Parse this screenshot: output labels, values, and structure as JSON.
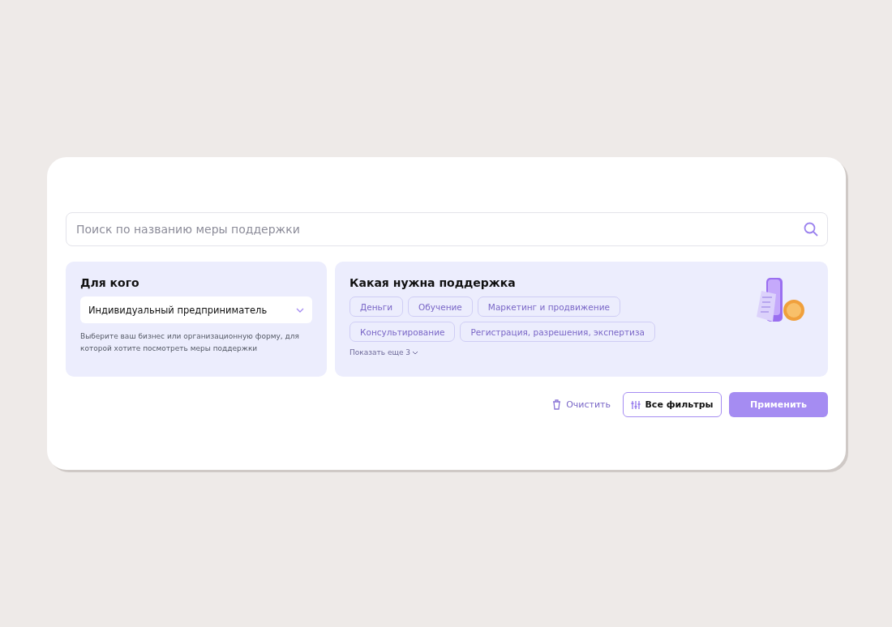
{
  "search": {
    "placeholder": "Поиск по названию меры поддержки"
  },
  "audience": {
    "title": "Для кого",
    "value": "Индивидуальный предприниматель",
    "hint": "Выберите ваш бизнес или организационную форму, для которой хотите посмотреть меры поддержки"
  },
  "support": {
    "title": "Какая нужна поддержка",
    "tags": [
      {
        "label": "Деньги",
        "selected": false
      },
      {
        "label": "Обучение",
        "selected": false
      },
      {
        "label": "Маркетинг и продвижение",
        "selected": false
      },
      {
        "label": "Консультирование",
        "selected": false
      },
      {
        "label": "Регистрация, разрешения, экспертиза",
        "selected": false
      }
    ],
    "show_more": "Показать еще 3"
  },
  "actions": {
    "clear": "Очистить",
    "all_filters": "Все фильтры",
    "apply": "Применить"
  }
}
